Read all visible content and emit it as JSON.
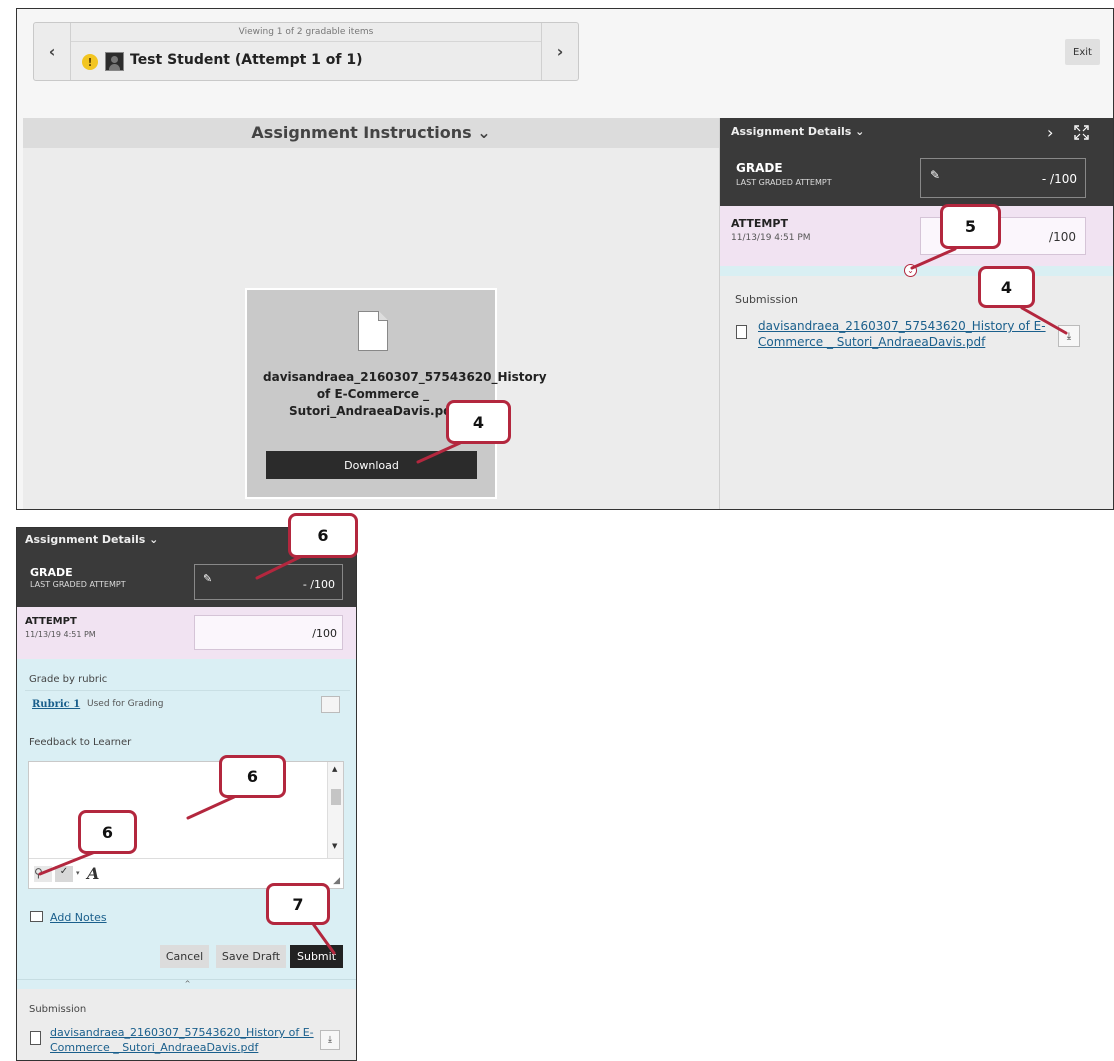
{
  "top": {
    "viewing_text": "Viewing 1 of 2 gradable items",
    "student_name": "Test Student (Attempt 1 of 1)",
    "prev_glyph": "‹",
    "next_glyph": "›",
    "exit_label": "Exit",
    "instructions_label": "Assignment Instructions ⌄",
    "file_name": "davisandraea_2160307_57543620_History of E-Commerce _ Sutori_AndraeaDavis.pdf",
    "download_label": "Download",
    "details_header": "Assignment Details ⌄",
    "grade_title": "GRADE",
    "grade_subtitle": "LAST GRADED ATTEMPT",
    "grade_value": "- /100",
    "attempt_title": "ATTEMPT",
    "attempt_date": "11/13/19 4:51 PM",
    "attempt_value": "/100",
    "submission_label": "Submission",
    "submission_link": "davisandraea_2160307_57543620_History of E-Commerce _ Sutori_AndraeaDavis.pdf"
  },
  "bottom": {
    "details_header": "Assignment Details ⌄",
    "grade_title": "GRADE",
    "grade_subtitle": "LAST GRADED ATTEMPT",
    "grade_value": "- /100",
    "attempt_title": "ATTEMPT",
    "attempt_date": "11/13/19 4:51 PM",
    "attempt_value": "/100",
    "rubric_label": "Grade by rubric",
    "rubric_link": "Rubric 1",
    "rubric_used": "Used for Grading",
    "feedback_label": "Feedback to Learner",
    "add_notes": "Add Notes",
    "cancel": "Cancel",
    "save_draft": "Save Draft",
    "submit": "Submit",
    "submission_label": "Submission",
    "submission_link": "davisandraea_2160307_57543620_History of E-Commerce _ Sutori_AndraeaDavis.pdf"
  },
  "callouts": {
    "download_step": "4",
    "download_icon_step": "4",
    "expand_step": "5",
    "grade_step": "6",
    "feedback_step": "6",
    "attach_step": "6",
    "submit_step": "7"
  },
  "colors": {
    "callout_border": "#b3273e",
    "dark_header": "#3a3a3a",
    "attempt_bg": "#f1e3f2",
    "link": "#1a5f8c"
  },
  "icons": [
    "warning-icon",
    "avatar-icon",
    "file-icon",
    "pencil-icon",
    "download-icon",
    "expand-icon",
    "attach-icon",
    "spellcheck-icon",
    "format-icon",
    "notes-icon"
  ]
}
